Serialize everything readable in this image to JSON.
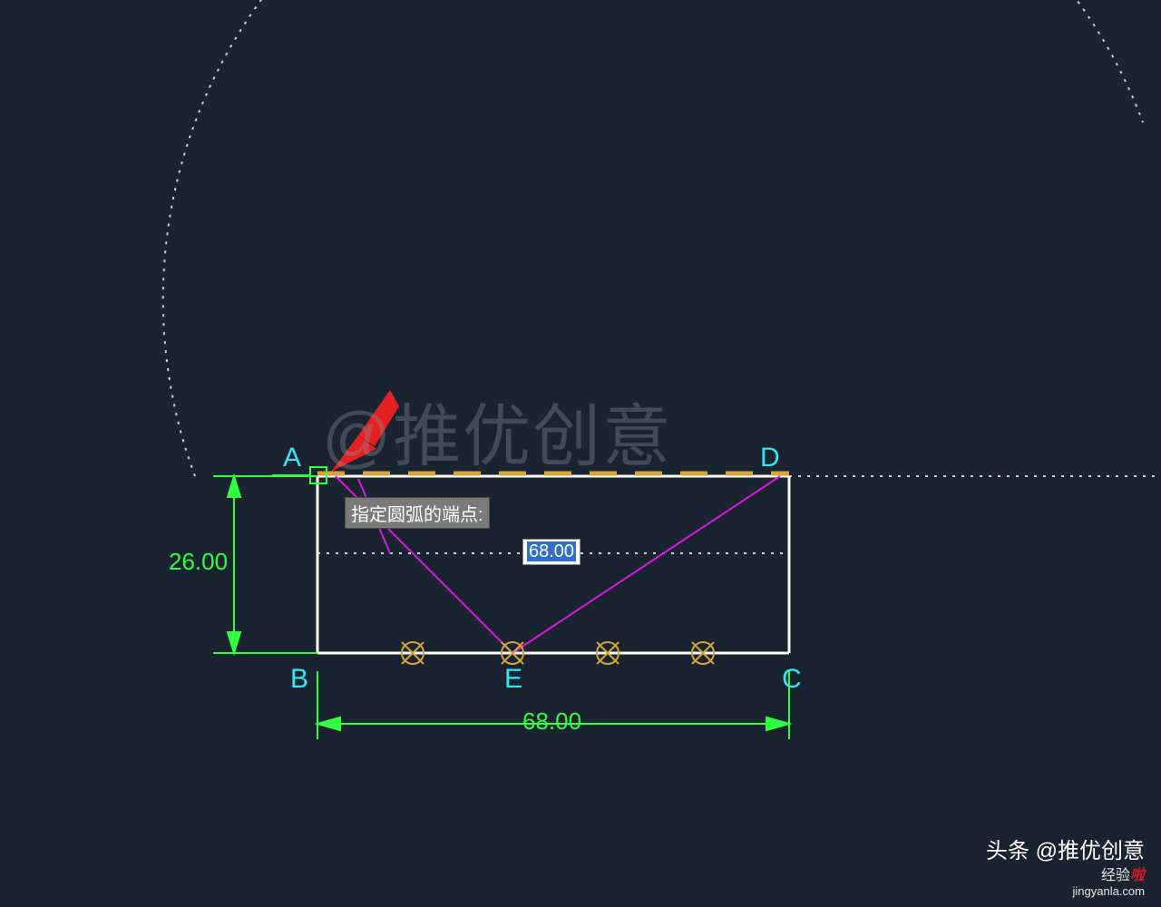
{
  "points": {
    "A": "A",
    "B": "B",
    "C": "C",
    "D": "D",
    "E": "E"
  },
  "dims": {
    "height": "26.00",
    "width": "68.00"
  },
  "tooltip": {
    "prompt": "指定圆弧的端点:",
    "dynamic_input": "68.00"
  },
  "watermark": "@推优创意",
  "footer": {
    "line1_prefix": "头条",
    "line1_handle": "@推优创意",
    "line2_prefix": "经验",
    "line2_brand": "啦",
    "line2_domain": "jingyanla.com"
  },
  "colors": {
    "bg": "#1a2330",
    "dim": "#2eff40",
    "pt": "#35e6f2",
    "construct": "#d81be0",
    "dash": "#d6a43a",
    "node": "#d6a43a"
  }
}
